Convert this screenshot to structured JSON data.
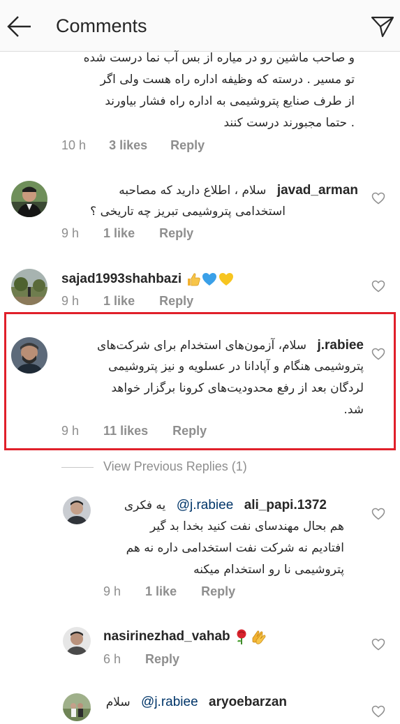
{
  "header": {
    "title": "Comments",
    "back_icon": "arrow-left-icon",
    "send_icon": "paper-plane-icon"
  },
  "comments": [
    {
      "text_lines": "و صاحب ماشین رو در میاره از بس آب نما درست شده\nتو مسیر . درسته که وظیفه اداره راه هست ولی اگر\nاز طرف صنایع  پتروشیمی به اداره راه فشار بیاورند\n. حتما مجبورند درست کنند",
      "time": "10 h",
      "likes": "3 likes",
      "reply": "Reply"
    },
    {
      "username": "javad_arman",
      "text_first": "سلام ، اطلاع دارید که مصاحبه",
      "text_rest": "استخدامی پتروشیمی تبریز چه تاریخی ؟",
      "time": "9 h",
      "likes": "1 like",
      "reply": "Reply"
    },
    {
      "username": "sajad1993shahbazi",
      "emojis": [
        "thumbs-up-emoji",
        "blue-heart-emoji",
        "yellow-heart-emoji"
      ],
      "time": "9 h",
      "likes": "1 like",
      "reply": "Reply"
    },
    {
      "username": "j.rabiee",
      "text_first": "سلام، آزمون‌های استخدام برای شرکت‌های",
      "text_rest": "پتروشیمی هنگام و آپادانا در عسلویه و نیز پتروشیمی\nلردگان بعد از رفع محدودیت‌های کرونا برگزار خواهد\nشد.",
      "time": "9 h",
      "likes": "11 likes",
      "reply": "Reply"
    }
  ],
  "view_previous_replies": "View Previous Replies (1)",
  "replies": [
    {
      "username": "ali_papi.1372",
      "mention": "@j.rabiee",
      "text_first": "یه فکری",
      "text_rest": "هم بحال مهندسای نفت کنید بخدا بد گیر\nافتادیم نه شرکت نفت استخدامی داره نه هم\nپتروشیمی نا رو استخدام میکنه",
      "time": "9 h",
      "likes": "1 like",
      "reply": "Reply"
    },
    {
      "username": "nasirinezhad_vahab",
      "emojis": [
        "rose-emoji",
        "clapping-hands-emoji"
      ],
      "time": "6 h",
      "reply": "Reply"
    },
    {
      "username": "aryoebarzan",
      "mention": "@j.rabiee",
      "text_first": "سلام"
    }
  ],
  "colors": {
    "highlight_border": "#e0202a",
    "mention": "#003569",
    "meta": "#8e8e8e"
  }
}
